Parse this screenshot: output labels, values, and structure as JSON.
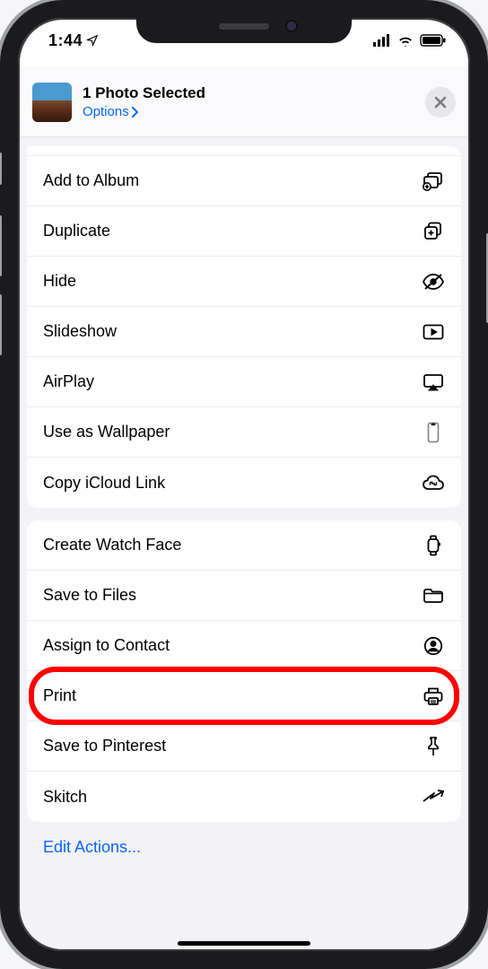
{
  "statusbar": {
    "time": "1:44"
  },
  "header": {
    "title": "1 Photo Selected",
    "options_label": "Options"
  },
  "groups": [
    {
      "items": [
        {
          "label": "Add to Album",
          "icon": "album-add-icon"
        },
        {
          "label": "Duplicate",
          "icon": "duplicate-icon"
        },
        {
          "label": "Hide",
          "icon": "hide-icon"
        },
        {
          "label": "Slideshow",
          "icon": "play-rect-icon"
        },
        {
          "label": "AirPlay",
          "icon": "airplay-icon"
        },
        {
          "label": "Use as Wallpaper",
          "icon": "wallpaper-icon"
        },
        {
          "label": "Copy iCloud Link",
          "icon": "icloud-link-icon"
        }
      ]
    },
    {
      "items": [
        {
          "label": "Create Watch Face",
          "icon": "watch-icon"
        },
        {
          "label": "Save to Files",
          "icon": "folder-icon"
        },
        {
          "label": "Assign to Contact",
          "icon": "contact-icon"
        },
        {
          "label": "Print",
          "icon": "printer-icon",
          "highlighted": true
        },
        {
          "label": "Save to Pinterest",
          "icon": "pin-icon"
        },
        {
          "label": "Skitch",
          "icon": "skitch-icon"
        }
      ]
    }
  ],
  "edit_actions_label": "Edit Actions..."
}
